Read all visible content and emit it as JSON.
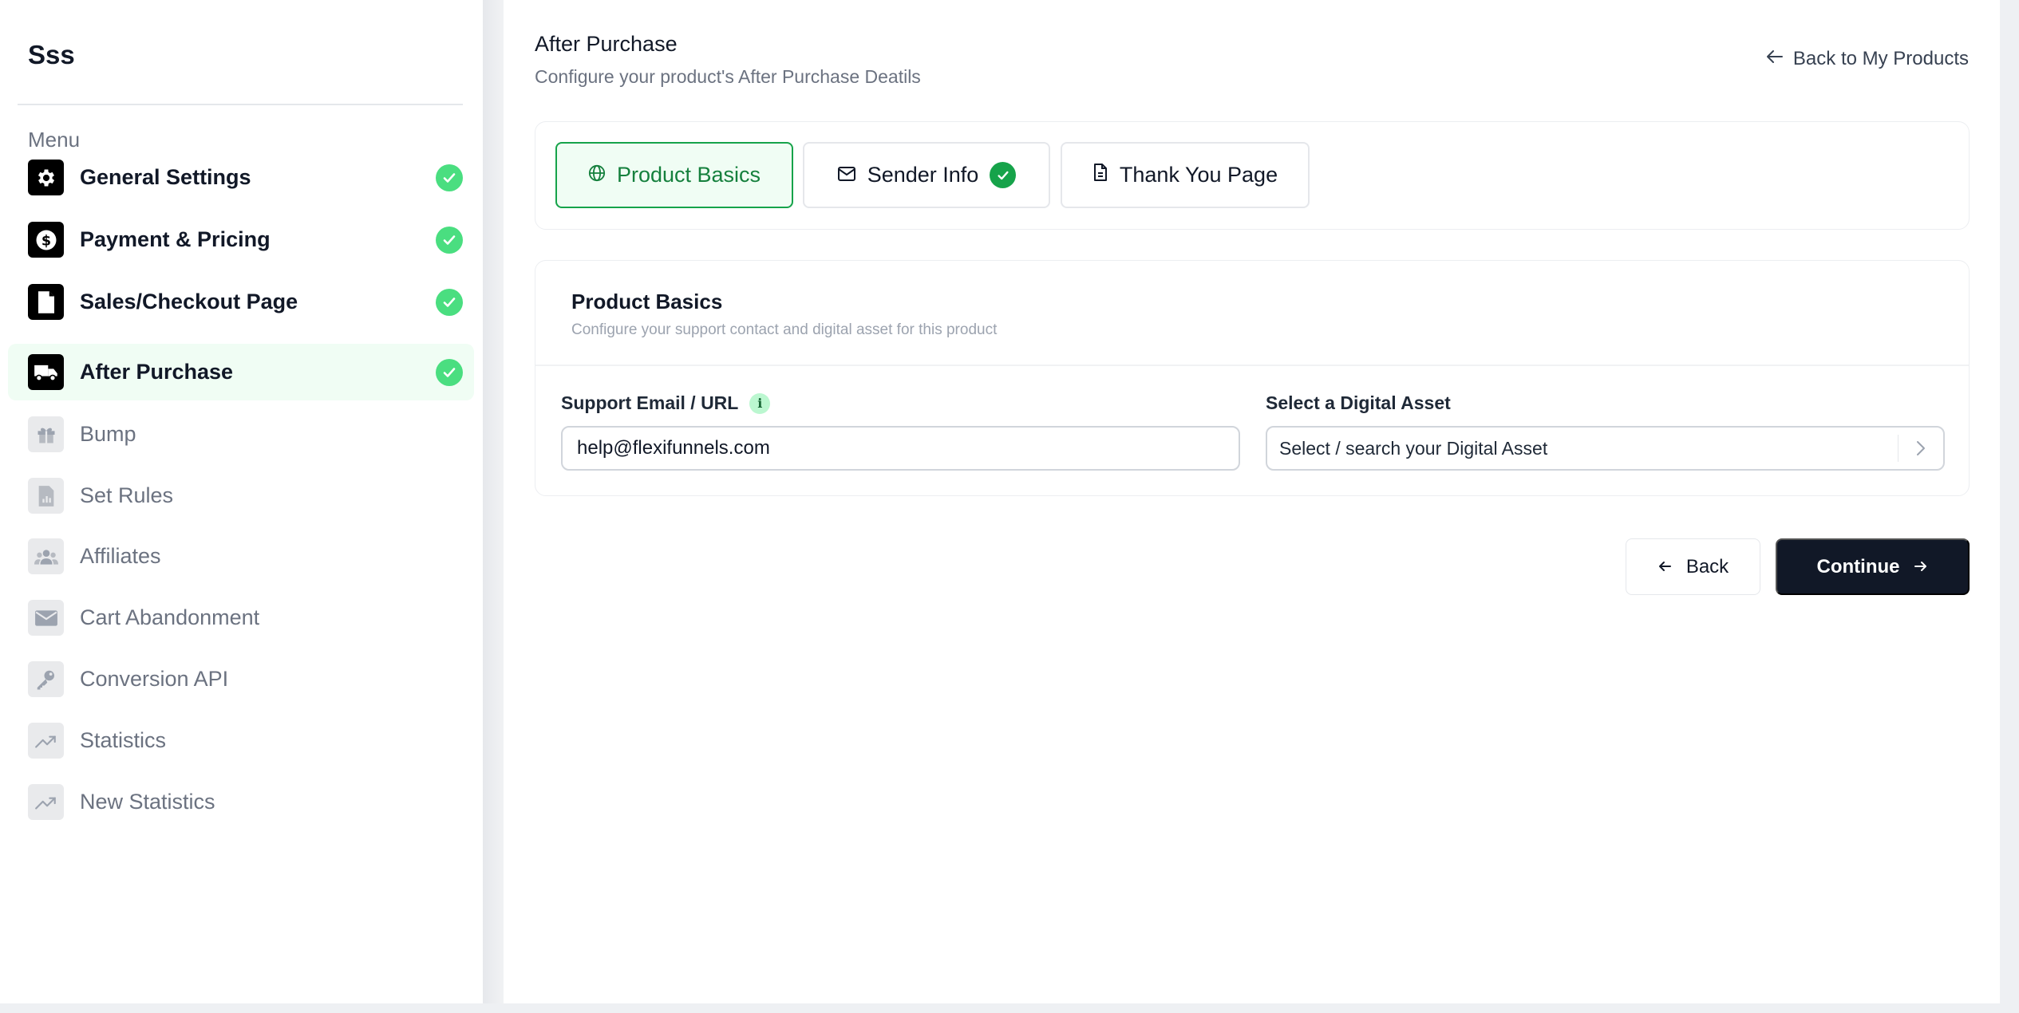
{
  "sidebar": {
    "brand": "Sss",
    "menu_heading": "Menu",
    "items": [
      {
        "label": "General Settings",
        "icon": "gear-icon",
        "status": "done"
      },
      {
        "label": "Payment & Pricing",
        "icon": "dollar-icon",
        "status": "done"
      },
      {
        "label": "Sales/Checkout Page",
        "icon": "document-icon",
        "status": "done"
      },
      {
        "label": "After Purchase",
        "icon": "truck-icon",
        "status": "done",
        "active": true
      },
      {
        "label": "Bump",
        "icon": "gift-icon",
        "status": "todo"
      },
      {
        "label": "Set Rules",
        "icon": "report-icon",
        "status": "todo"
      },
      {
        "label": "Affiliates",
        "icon": "users-icon",
        "status": "todo"
      },
      {
        "label": "Cart Abandonment",
        "icon": "envelope-icon",
        "status": "todo"
      },
      {
        "label": "Conversion API",
        "icon": "key-icon",
        "status": "todo"
      },
      {
        "label": "Statistics",
        "icon": "trend-icon",
        "status": "todo"
      },
      {
        "label": "New Statistics",
        "icon": "trend-icon",
        "status": "todo"
      }
    ]
  },
  "header": {
    "title": "After Purchase",
    "subtitle": "Configure your product's After Purchase Deatils",
    "back_link": "Back to My Products"
  },
  "tabs": [
    {
      "label": "Product Basics",
      "icon": "globe-icon",
      "selected": true
    },
    {
      "label": "Sender Info",
      "icon": "mail-icon",
      "completed": true
    },
    {
      "label": "Thank You Page",
      "icon": "file-icon"
    }
  ],
  "form": {
    "title": "Product Basics",
    "description": "Configure your support contact and digital asset for this product",
    "support_label": "Support Email / URL",
    "support_info": "i",
    "support_value": "help@flexifunnels.com",
    "asset_label": "Select a Digital Asset",
    "asset_placeholder": "Select / search your Digital Asset"
  },
  "actions": {
    "back_label": "Back",
    "continue_label": "Continue"
  },
  "colors": {
    "accent_green": "#16a34a",
    "check_green": "#4ade80",
    "active_bg": "#f0fdf4",
    "primary_dark": "#111827"
  }
}
